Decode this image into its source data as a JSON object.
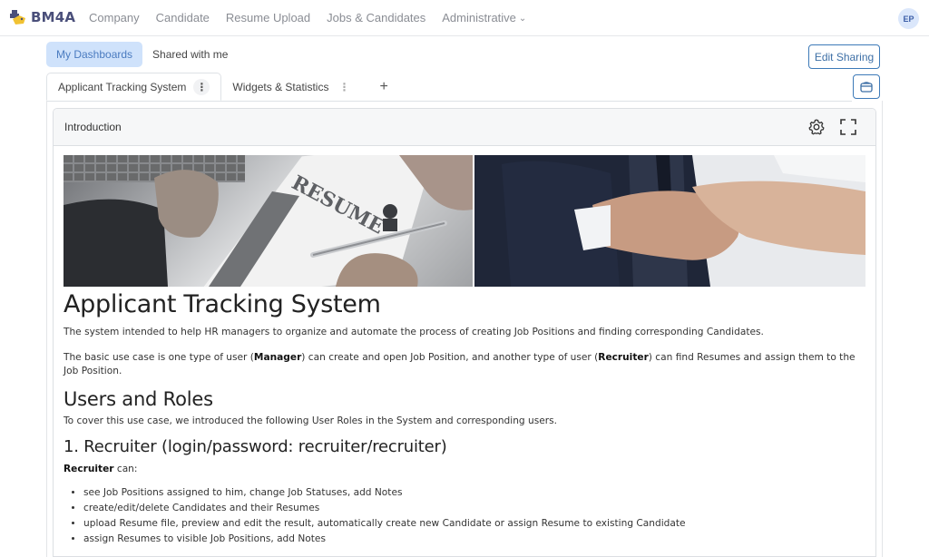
{
  "app": {
    "brand": "BM4A",
    "nav": [
      {
        "label": "Company"
      },
      {
        "label": "Candidate"
      },
      {
        "label": "Resume Upload"
      },
      {
        "label": "Jobs & Candidates"
      },
      {
        "label": "Administrative",
        "has_dropdown": true
      }
    ],
    "user_initials": "EP",
    "colors": {
      "accent": "#3d7ab8",
      "active_pill": "#cfe2fb",
      "avatar_bg": "#dbe7fb"
    }
  },
  "dashboard_switch": {
    "items": [
      {
        "label": "My Dashboards",
        "active": true
      },
      {
        "label": "Shared with me",
        "active": false
      }
    ]
  },
  "toolbar": {
    "edit_sharing_label": "Edit Sharing",
    "collapse_icon": "window-icon"
  },
  "tabs": {
    "items": [
      {
        "label": "Applicant Tracking System",
        "active": true,
        "menu_icon": "kebab-icon"
      },
      {
        "label": "Widgets & Statistics",
        "active": false,
        "menu_icon": "kebab-icon"
      }
    ],
    "add_label": "+"
  },
  "widget": {
    "title": "Introduction",
    "settings_icon": "gear-icon",
    "fullscreen_icon": "fullscreen-icon",
    "banner": {
      "left_image": "resume-paper-photo",
      "right_image": "handshake-photo",
      "resume_word": "RESUME"
    },
    "content": {
      "h1": "Applicant Tracking System",
      "p1": "The system intended to help HR managers to organize and automate the process of creating Job Positions and finding corresponding Candidates.",
      "p2_pre": "The basic use case is one type of user (",
      "p2_b1": "Manager",
      "p2_mid": ") can create and open Job Position, and another type of user (",
      "p2_b2": "Recruiter",
      "p2_post": ") can find Resumes and assign them to the Job Position.",
      "h2": "Users and Roles",
      "p3": "To cover this use case, we introduced the following User Roles in the System and corresponding users.",
      "h3": "1. Recruiter (login/password: recruiter/recruiter)",
      "p4_b": "Recruiter",
      "p4_post": " can:",
      "list": [
        "see Job Positions assigned to him, change Job Statuses, add Notes",
        "create/edit/delete Candidates and their Resumes",
        "upload Resume file, preview and edit the result, automatically create new Candidate or assign Resume to existing Candidate",
        "assign Resumes to visible Job Positions, add Notes"
      ]
    }
  }
}
